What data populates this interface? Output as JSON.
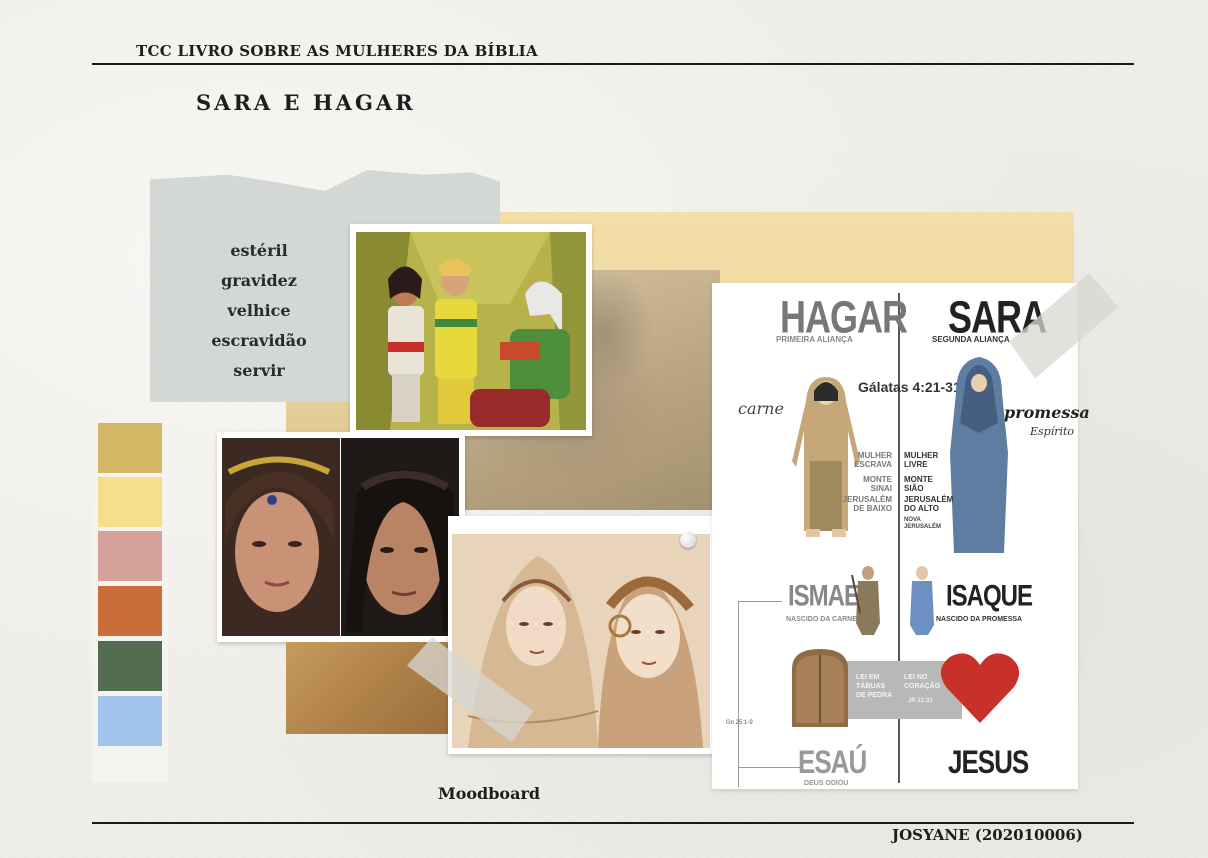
{
  "header": {
    "title": "TCC LIVRO SOBRE AS MULHERES DA BÍBLIA"
  },
  "page_title": "SARA E HAGAR",
  "keywords": [
    "estéril",
    "gravidez",
    "velhice",
    "escravidão",
    "servir"
  ],
  "palette": [
    "#d4b765",
    "#f6df8c",
    "#d4a29b",
    "#c86d3a",
    "#546c50",
    "#a2c4ec"
  ],
  "moodboard_label": "Moodboard",
  "footer": {
    "author": "JOSYANE (202010006)"
  },
  "infographic": {
    "left_name": "HAGAR",
    "left_sub": "PRIMEIRA ALIANÇA",
    "right_name": "SARA",
    "right_sub": "SEGUNDA ALIANÇA",
    "verse": "Gálatas 4:21-31",
    "carne": "carne",
    "promessa": "promessa",
    "espirito": "Espírito",
    "left_labels": [
      "MULHER ESCRAVA",
      "MONTE SINAI",
      "JERUSALÉM DE BAIXO"
    ],
    "right_labels": [
      "MULHER LIVRE",
      "MONTE SIÃO",
      "JERUSALÉM DO ALTO",
      "NOVA JERUSALÉM"
    ],
    "son_left": "ISMAEL",
    "son_left_sub": "NASCIDO DA CARNE",
    "son_right": "ISAQUE",
    "son_right_sub": "NASCIDO DA PROMESSA",
    "law_left": "LEI EM TÁBUAS DE PEDRA",
    "law_right": "LEI NO CORAÇÃO",
    "law_right_ref": "JR 31:33",
    "ref_left": "Gn 25:1-9",
    "bottom_left": "ESAÚ",
    "bottom_left_sub": "DEUS ODIOU",
    "bottom_right": "JESUS"
  }
}
